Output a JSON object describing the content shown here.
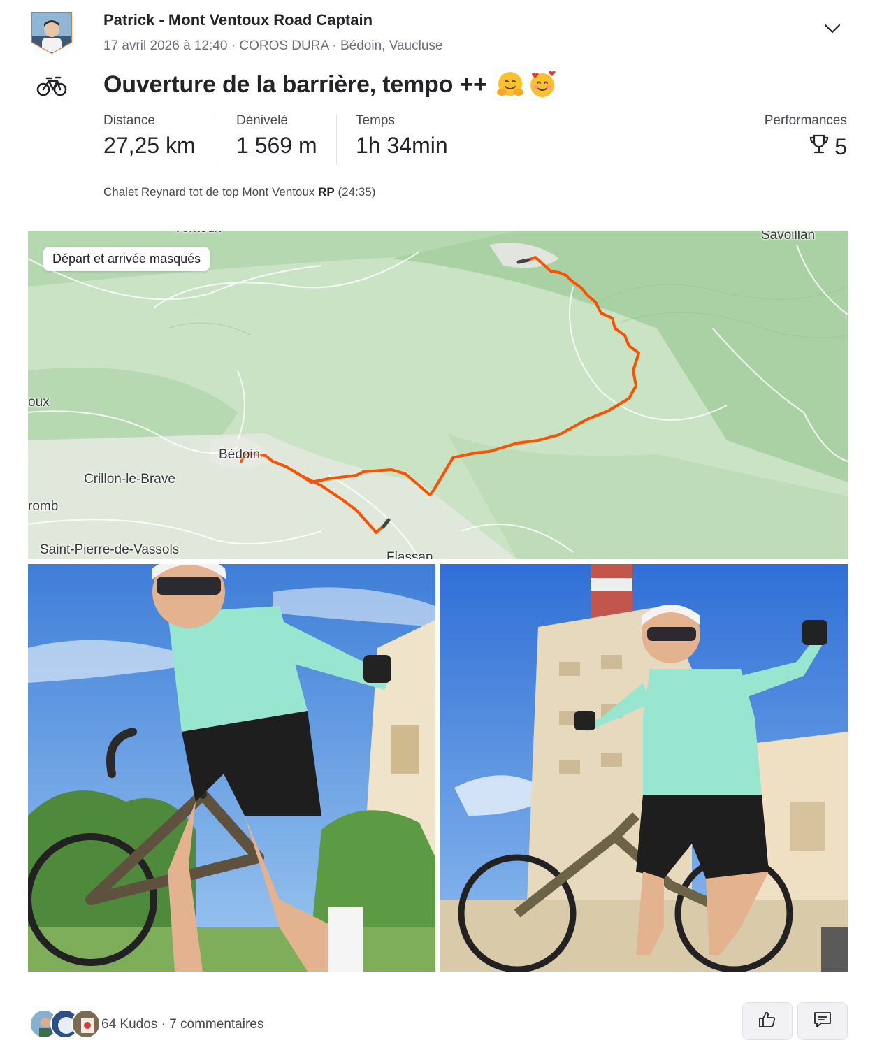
{
  "athlete": {
    "name": "Patrick - Mont Ventoux Road Captain",
    "meta": "17 avril 2026 à 12:40 · COROS DURA · Bédoin, Vaucluse",
    "avatar_icon": "athlete-avatar"
  },
  "activity": {
    "sport_icon": "bike-icon",
    "title": "Ouverture de la barrière, tempo ++",
    "title_emojis": [
      "hugging-face-emoji",
      "smiling-face-with-hearts-emoji"
    ],
    "stats": [
      {
        "label": "Distance",
        "value": "27,25 km"
      },
      {
        "label": "Dénivelé",
        "value": "1 569 m"
      },
      {
        "label": "Temps",
        "value": "1h 34min"
      }
    ],
    "performances": {
      "label": "Performances",
      "value": "5",
      "icon": "trophy-icon"
    },
    "segment": {
      "name": "Chalet Reynard tot de top Mont Ventoux",
      "badge": "RP",
      "time": "(24:35)"
    }
  },
  "map": {
    "privacy_badge": "Départ et arrivée masqués",
    "labels": [
      "Ventoux",
      "Savoillan",
      "oux",
      "Bédoin",
      "Crillon-le-Brave",
      "romb",
      "Saint-Pierre-de-Vassols",
      "Flassan"
    ],
    "route_color": "#fc5200"
  },
  "photos": [
    {
      "name": "photo-1",
      "description_icon": "cyclist-photo"
    },
    {
      "name": "photo-2",
      "description_icon": "cyclist-summit-photo"
    }
  ],
  "social": {
    "kudos": "64 Kudos",
    "separator": "·",
    "comments": "7 commentaires"
  },
  "colors": {
    "text": "#242428",
    "muted": "#6d6d78",
    "accent": "#fc5200",
    "map_green": "#c7e2c3"
  }
}
